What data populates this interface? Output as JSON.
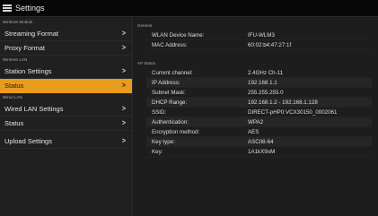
{
  "titlebar": {
    "title": "Settings",
    "menu_icon": "hamburger-menu-icon"
  },
  "sidebar": {
    "sections": [
      {
        "header": "Wireless Module",
        "items": [
          {
            "label": "Streaming Format",
            "active": false
          },
          {
            "label": "Proxy Format",
            "active": false
          }
        ]
      },
      {
        "header": "Wireless LAN",
        "items": [
          {
            "label": "Station Settings",
            "active": false
          },
          {
            "label": "Status",
            "active": true
          }
        ]
      },
      {
        "header": "Wired LAN",
        "items": [
          {
            "label": "Wired LAN Settings",
            "active": false
          },
          {
            "label": "Status",
            "active": false
          }
        ]
      },
      {
        "header": "",
        "items": [
          {
            "label": "Upload Settings",
            "active": false
          }
        ]
      }
    ],
    "chevron": ">"
  },
  "main": {
    "general": {
      "header": "General",
      "rows": [
        {
          "label": "WLAN Device Name:",
          "value": "IFU-WLM3"
        },
        {
          "label": "MAC Address:",
          "value": "60:02:b4:47:27:1f"
        }
      ]
    },
    "ap_status": {
      "header": "AP Status",
      "rows": [
        {
          "label": "Current channel:",
          "value": "2.4GHz Ch-11"
        },
        {
          "label": "IP Address:",
          "value": "192.168.1.1"
        },
        {
          "label": "Subnet Mask:",
          "value": "255.255.255.0"
        },
        {
          "label": "DHCP Range:",
          "value": "192.168.1.2 - 192.168.1.128"
        },
        {
          "label": "SSID:",
          "value": "DIRECT-pHP0:VCX30150_0002061"
        },
        {
          "label": "Authentication:",
          "value": "WPA2"
        },
        {
          "label": "Encryption method:",
          "value": "AES"
        },
        {
          "label": "Key type:",
          "value": "ASCII8-64"
        },
        {
          "label": "Key:",
          "value": "1A1kX9oM"
        }
      ]
    }
  },
  "colors": {
    "accent": "#e89c1c",
    "background": "#1c1c1c",
    "titlebar": "#080808"
  }
}
